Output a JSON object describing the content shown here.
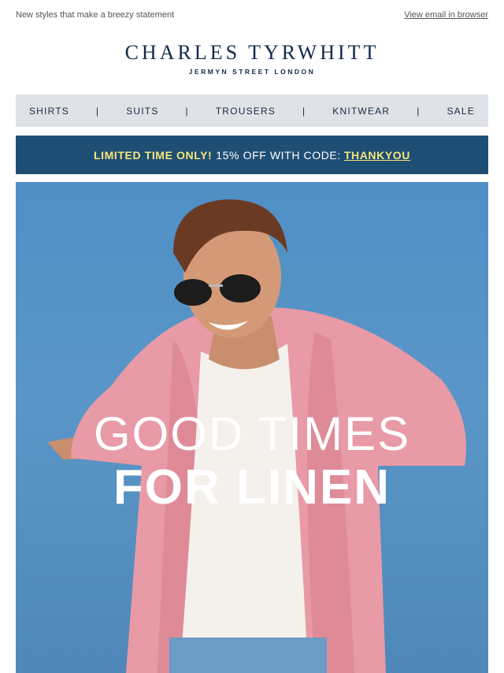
{
  "preheader": {
    "text": "New styles that make a breezy statement",
    "view_link": "View email in browser"
  },
  "logo": {
    "brand": "CHARLES TYRWHITT",
    "tagline": "JERMYN STREET LONDON"
  },
  "nav": {
    "items": [
      {
        "label": "SHIRTS"
      },
      {
        "label": "SUITS"
      },
      {
        "label": "TROUSERS"
      },
      {
        "label": "KNITWEAR"
      },
      {
        "label": "SALE"
      }
    ],
    "separator": "|"
  },
  "promo": {
    "lead": "LIMITED TIME ONLY!",
    "text": "15% OFF WITH CODE:",
    "code": "THANKYOU"
  },
  "hero": {
    "line1": "GOOD TIMES",
    "line2": "FOR LINEN"
  },
  "colors": {
    "navy": "#13294b",
    "promo_bg": "#1f4e75",
    "promo_accent": "#f5e67a",
    "nav_bg": "#dfe3e8",
    "sky": "#5a96c8",
    "shirt": "#e89aa6"
  }
}
